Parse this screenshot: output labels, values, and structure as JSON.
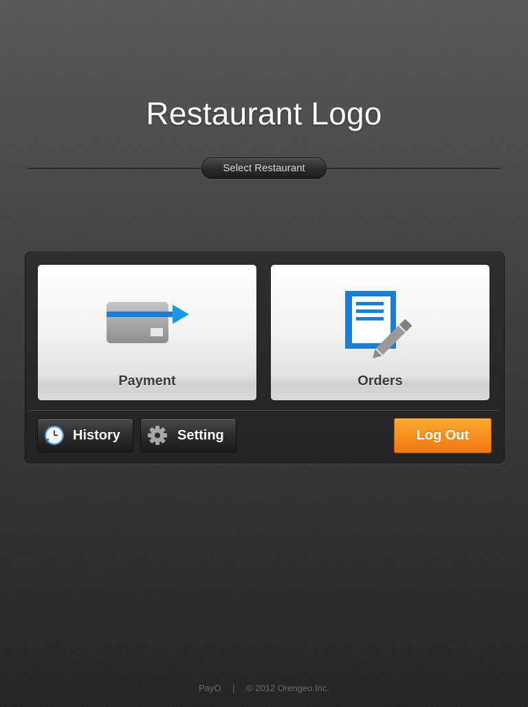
{
  "header": {
    "logo_text": "Restaurant Logo",
    "select_restaurant_label": "Select Restaurant"
  },
  "tiles": {
    "payment_label": "Payment",
    "orders_label": "Orders"
  },
  "toolbar": {
    "history_label": "History",
    "setting_label": "Setting",
    "logout_label": "Log Out"
  },
  "footer": {
    "brand": "PayO",
    "separator": "|",
    "copyright": "© 2012 Orengeo Inc."
  },
  "icons": {
    "payment": "credit-card-arrow-icon",
    "orders": "document-pencil-icon",
    "history": "clock-icon",
    "setting": "gear-icon"
  },
  "colors": {
    "accent_blue": "#1a7fd4",
    "logout_orange": "#f7901e",
    "background_dark": "#3e3d3f"
  }
}
